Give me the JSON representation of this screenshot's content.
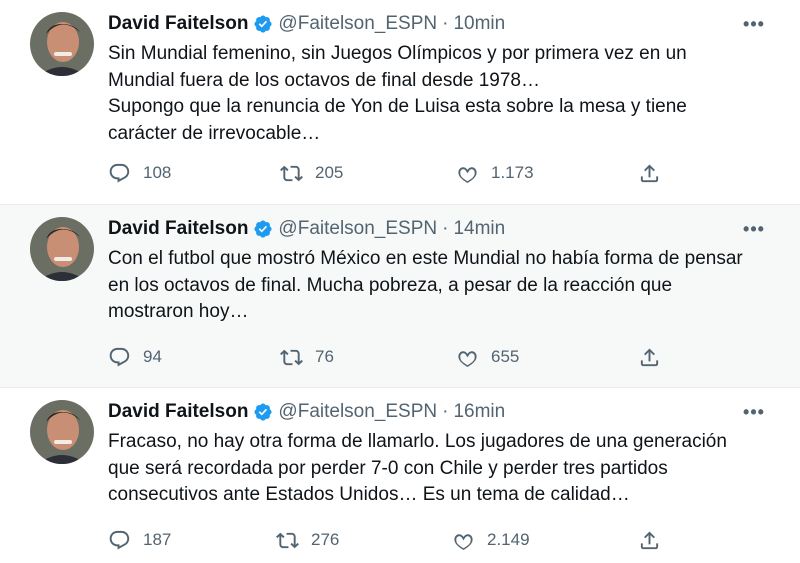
{
  "tweets": [
    {
      "author_name": "David Faitelson",
      "handle": "@Faitelson_ESPN",
      "separator": "·",
      "time": "10min",
      "lines": [
        "Sin Mundial femenino, sin Juegos Olímpicos y por primera vez en un",
        "Mundial fuera de los octavos de final desde 1978…",
        "Supongo que la renuncia de Yon de Luisa esta sobre la mesa y tiene",
        "carácter de irrevocable…"
      ],
      "replies": "108",
      "retweets": "205",
      "likes": "1.173"
    },
    {
      "author_name": "David Faitelson",
      "handle": "@Faitelson_ESPN",
      "separator": "·",
      "time": "14min",
      "lines": [
        "Con el futbol que mostró México en este Mundial no había forma de pensar",
        "en los octavos de final. Mucha pobreza, a pesar de la reacción que",
        "mostraron hoy…"
      ],
      "replies": "94",
      "retweets": "76",
      "likes": "655"
    },
    {
      "author_name": "David Faitelson",
      "handle": "@Faitelson_ESPN",
      "separator": "·",
      "time": "16min",
      "lines": [
        "Fracaso, no hay otra forma de llamarlo. Los jugadores de una generación",
        "que será recordada por perder 7-0 con Chile y perder tres partidos",
        "consecutivos ante Estados Unidos… Es un tema de calidad…"
      ],
      "replies": "187",
      "retweets": "276",
      "likes": "2.149"
    }
  ],
  "icons": {
    "more": "more-horizontal-icon",
    "verified": "verified-badge-icon",
    "reply": "reply-icon",
    "retweet": "retweet-icon",
    "like": "heart-icon",
    "share": "share-icon"
  },
  "colors": {
    "verified": "#1d9bf0",
    "secondary_text": "#536471",
    "primary_text": "#0f1419",
    "highlight_bg": "#f7f9f9"
  }
}
